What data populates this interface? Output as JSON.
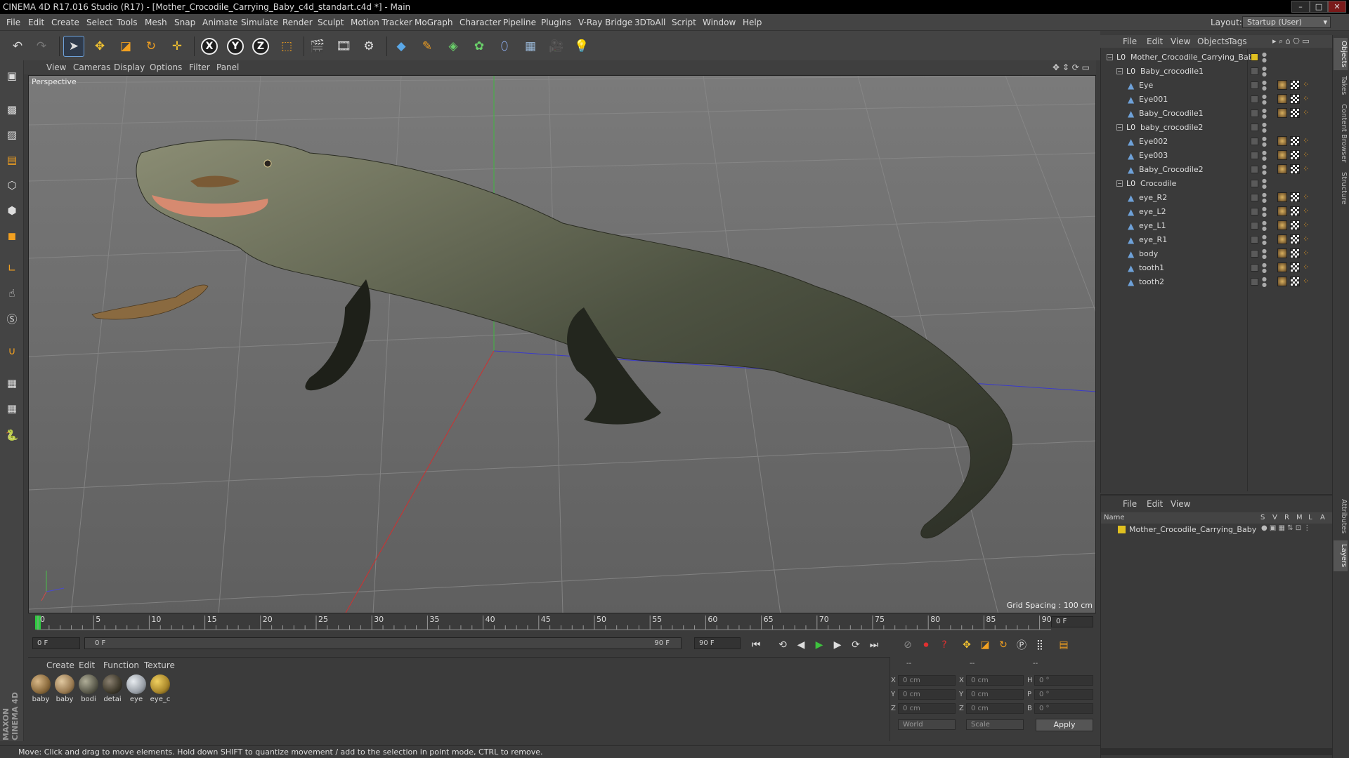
{
  "window": {
    "title": "CINEMA 4D R17.016 Studio (R17) - [Mother_Crocodile_Carrying_Baby_c4d_standart.c4d *] - Main",
    "buttons": [
      "–",
      "□",
      "✕"
    ]
  },
  "menubar": {
    "items": [
      "File",
      "Edit",
      "Create",
      "Select",
      "Tools",
      "Mesh",
      "Snap",
      "Animate",
      "Simulate",
      "Render",
      "Sculpt",
      "Motion Tracker",
      "MoGraph",
      "Character",
      "Pipeline",
      "Plugins",
      "V-Ray Bridge",
      "3DToAll",
      "Script",
      "Window",
      "Help"
    ],
    "layout_label": "Layout:",
    "layout_value": "Startup (User)"
  },
  "viewport": {
    "menu": [
      "View",
      "Cameras",
      "Display",
      "Options",
      "Filter",
      "Panel"
    ],
    "label": "Perspective",
    "grid_spacing": "Grid Spacing : 100 cm"
  },
  "timeline": {
    "ticks": [
      "0",
      "5",
      "10",
      "15",
      "20",
      "25",
      "30",
      "35",
      "40",
      "45",
      "50",
      "55",
      "60",
      "65",
      "70",
      "75",
      "80",
      "85",
      "90"
    ],
    "current_frame_field": "0 F",
    "start_field": "0 F",
    "slider_start": "0 F",
    "slider_end": "90 F",
    "end_field": "90 F"
  },
  "material_manager": {
    "menu": [
      "Create",
      "Edit",
      "Function",
      "Texture"
    ],
    "materials": [
      {
        "label": "baby",
        "color": "#8a6a3c"
      },
      {
        "label": "baby",
        "color": "#9a7b52"
      },
      {
        "label": "bodi",
        "color": "#5b5a4c"
      },
      {
        "label": "detai",
        "color": "#3f3a2c"
      },
      {
        "label": "eye",
        "color": "#9aa0a8"
      },
      {
        "label": "eye_c",
        "color": "#a8862a"
      }
    ]
  },
  "coordinates": {
    "headers": [
      "--",
      "--",
      "--"
    ],
    "rows": [
      {
        "axis": "X",
        "pos": "0 cm",
        "axis2": "X",
        "size": "0 cm",
        "rot_axis": "H",
        "rot": "0 °"
      },
      {
        "axis": "Y",
        "pos": "0 cm",
        "axis2": "Y",
        "size": "0 cm",
        "rot_axis": "P",
        "rot": "0 °"
      },
      {
        "axis": "Z",
        "pos": "0 cm",
        "axis2": "Z",
        "size": "0 cm",
        "rot_axis": "B",
        "rot": "0 °"
      }
    ],
    "mode_world": "World",
    "mode_scale": "Scale",
    "apply": "Apply"
  },
  "status_bar": "Move: Click and drag to move elements. Hold down SHIFT to quantize movement / add to the selection in point mode, CTRL to remove.",
  "object_manager": {
    "menu": [
      "File",
      "Edit",
      "View",
      "Objects",
      "Tags"
    ],
    "objects": [
      {
        "name": "Mother_Crocodile_Carrying_Baby",
        "type": "null",
        "depth": 0
      },
      {
        "name": "Baby_crocodile1",
        "type": "null",
        "depth": 1
      },
      {
        "name": "Eye",
        "type": "mesh",
        "depth": 2
      },
      {
        "name": "Eye001",
        "type": "mesh",
        "depth": 2
      },
      {
        "name": "Baby_Crocodile1",
        "type": "mesh",
        "depth": 2
      },
      {
        "name": "baby_crocodile2",
        "type": "null",
        "depth": 1
      },
      {
        "name": "Eye002",
        "type": "mesh",
        "depth": 2
      },
      {
        "name": "Eye003",
        "type": "mesh",
        "depth": 2
      },
      {
        "name": "Baby_Crocodile2",
        "type": "mesh",
        "depth": 2
      },
      {
        "name": "Crocodile",
        "type": "null",
        "depth": 1
      },
      {
        "name": "eye_R2",
        "type": "mesh",
        "depth": 2
      },
      {
        "name": "eye_L2",
        "type": "mesh",
        "depth": 2
      },
      {
        "name": "eye_L1",
        "type": "mesh",
        "depth": 2
      },
      {
        "name": "eye_R1",
        "type": "mesh",
        "depth": 2
      },
      {
        "name": "body",
        "type": "mesh",
        "depth": 2
      },
      {
        "name": "tooth1",
        "type": "mesh",
        "depth": 2
      },
      {
        "name": "tooth2",
        "type": "mesh",
        "depth": 2
      }
    ]
  },
  "layer_manager": {
    "menu": [
      "File",
      "Edit",
      "View"
    ],
    "columns": [
      "Name",
      "S",
      "V",
      "R",
      "M",
      "L",
      "A"
    ],
    "layers": [
      {
        "name": "Mother_Crocodile_Carrying_Baby",
        "color": "#e0c020"
      }
    ]
  },
  "side_tabs": [
    "Objects",
    "Takes",
    "Content Browser",
    "Structure",
    "Attributes",
    "Layers"
  ],
  "brand": "MAXON CINEMA 4D"
}
